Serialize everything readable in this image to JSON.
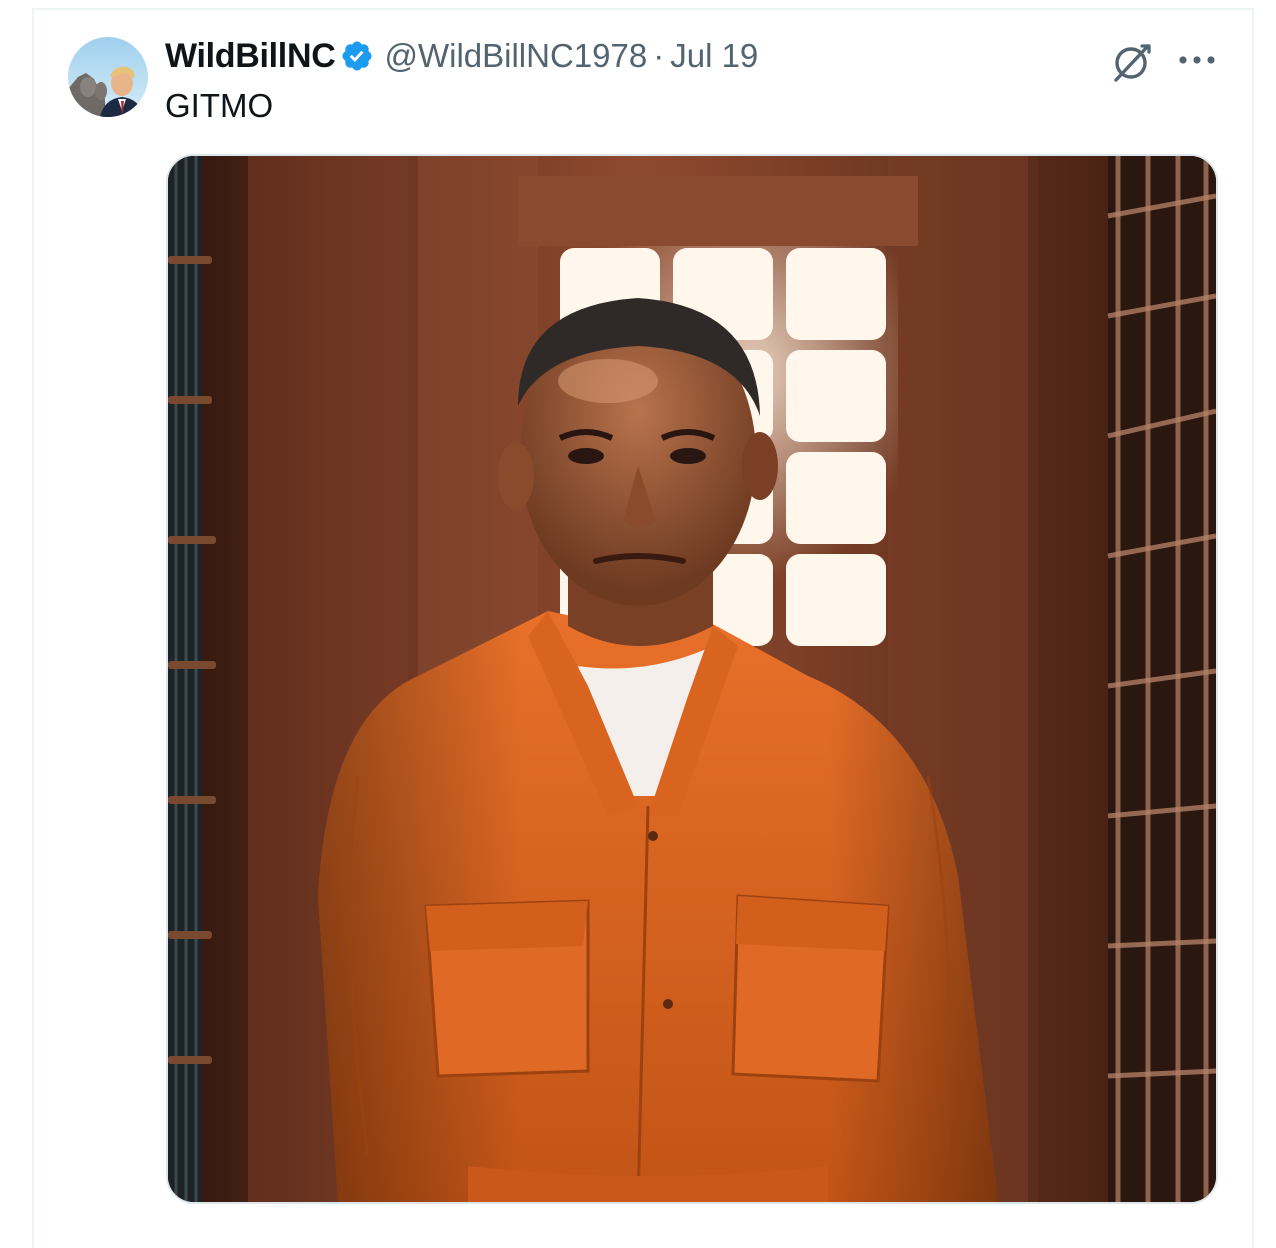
{
  "tweet": {
    "author": {
      "display_name": "WildBillNC",
      "verified": true,
      "handle": "@WildBillNC1978"
    },
    "separator": "·",
    "date": "Jul 19",
    "text": "GITMO",
    "icons": {
      "verified": "verified-badge-icon",
      "grok": "grok-icon",
      "more": "more-icon"
    },
    "media": {
      "kind": "photo"
    }
  },
  "colors": {
    "text_primary": "#0f1419",
    "text_secondary": "#536471",
    "verified_blue": "#1d9bf0",
    "border": "#eef3f4"
  }
}
